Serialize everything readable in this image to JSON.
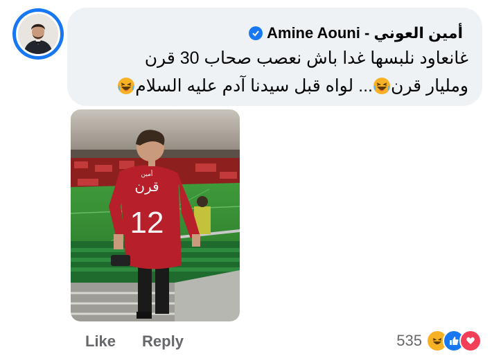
{
  "comment": {
    "author": "Amine Aouni - أمين العوني",
    "line1": "غانعاود نلبسها غدا باش نعصب صحاب 30 قرن",
    "line2_before_emoji": "ومليار قرن",
    "line2_mid": "... لواه قبل سيدنا آدم عليه السلام",
    "photo": {
      "jersey_name": "قرن",
      "jersey_small_name": "أمين",
      "jersey_number": "12"
    }
  },
  "actions": {
    "like_label": "Like",
    "reply_label": "Reply"
  },
  "reactions": {
    "count": "535",
    "types": [
      "haha-icon",
      "like-icon",
      "love-icon"
    ]
  },
  "colors": {
    "accent": "#1877f2",
    "bubble": "#eff2f5",
    "muted_text": "#65676b",
    "love": "#f33e58",
    "haha": "#f7b125"
  }
}
